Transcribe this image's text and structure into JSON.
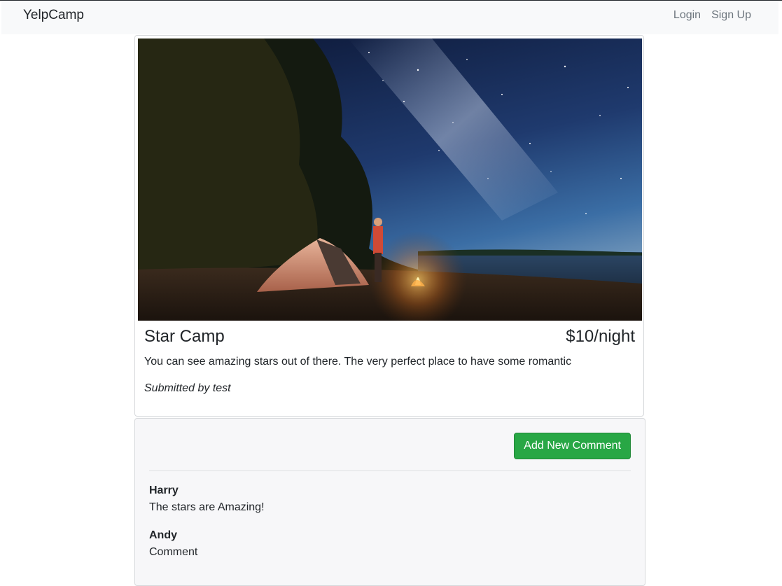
{
  "navbar": {
    "brand": "YelpCamp",
    "login": "Login",
    "signup": "Sign Up"
  },
  "campground": {
    "name": "Star Camp",
    "price": "$10/night",
    "description": "You can see amazing stars out of there. The very perfect place to have some romantic",
    "submitted_by": "Submitted by test"
  },
  "comments_section": {
    "add_button_label": "Add New Comment",
    "button_color": "#28a745",
    "comments": [
      {
        "author": "Harry",
        "text": "The stars are Amazing!"
      },
      {
        "author": "Andy",
        "text": "Comment"
      }
    ]
  }
}
